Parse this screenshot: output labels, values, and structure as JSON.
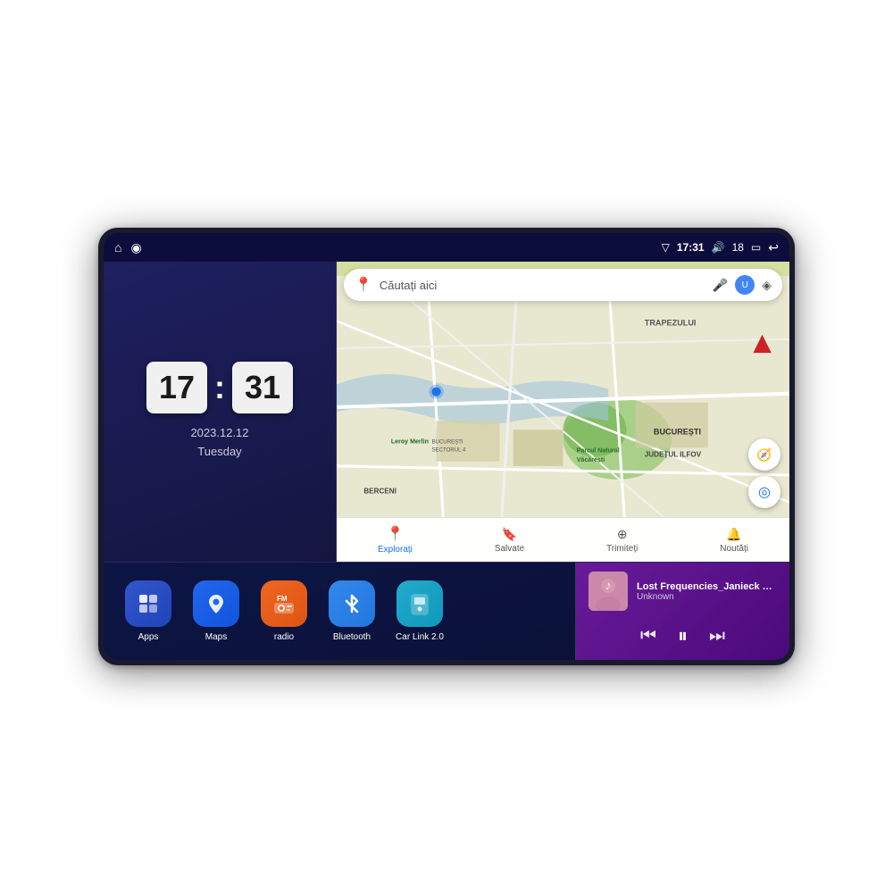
{
  "device": {
    "status_bar": {
      "left_icons": [
        "home",
        "maps-pin"
      ],
      "time": "17:31",
      "signal_icon": "signal",
      "volume_icon": "volume",
      "volume_level": "18",
      "battery_icon": "battery",
      "back_icon": "back"
    },
    "clock": {
      "hours": "17",
      "minutes": "31",
      "date": "2023.12.12",
      "day": "Tuesday"
    },
    "map": {
      "search_placeholder": "Căutați aici",
      "labels": [
        "TRAPEZULUI",
        "BUCUREȘTI",
        "JUDEȚUL ILFOV",
        "BERCENI",
        "Parcul Natural Văcărești",
        "Leroy Merlin",
        "BUCUREȘTI SECTORUL 4"
      ],
      "nav_items": [
        {
          "label": "Explorați",
          "icon": "📍",
          "active": true
        },
        {
          "label": "Salvate",
          "icon": "🔖",
          "active": false
        },
        {
          "label": "Trimiteți",
          "icon": "⊕",
          "active": false
        },
        {
          "label": "Noutăți",
          "icon": "🔔",
          "active": false
        }
      ]
    },
    "apps": [
      {
        "id": "apps",
        "label": "Apps",
        "icon": "⊞",
        "bg_class": "icon-apps"
      },
      {
        "id": "maps",
        "label": "Maps",
        "icon": "🗺",
        "bg_class": "icon-maps"
      },
      {
        "id": "radio",
        "label": "radio",
        "icon": "📻",
        "bg_class": "icon-radio"
      },
      {
        "id": "bluetooth",
        "label": "Bluetooth",
        "icon": "⬡",
        "bg_class": "icon-bluetooth"
      },
      {
        "id": "carlink",
        "label": "Car Link 2.0",
        "icon": "📱",
        "bg_class": "icon-carlink"
      }
    ],
    "music": {
      "title": "Lost Frequencies_Janieck Devy-...",
      "artist": "Unknown",
      "controls": {
        "prev": "⏮",
        "play": "⏸",
        "next": "⏭"
      }
    }
  }
}
